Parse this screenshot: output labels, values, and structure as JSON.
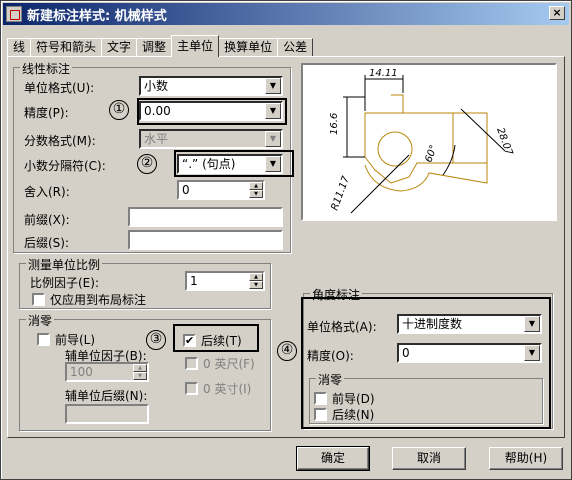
{
  "window": {
    "title": "新建标注样式: 机械样式",
    "close_label": "×"
  },
  "tabs": [
    "线",
    "符号和箭头",
    "文字",
    "调整",
    "主单位",
    "换算单位",
    "公差"
  ],
  "active_tab_index": 4,
  "linear": {
    "group_title": "线性标注",
    "unit_format_label": "单位格式(U):",
    "unit_format_value": "小数",
    "precision_label": "精度(P):",
    "precision_value": "0.00",
    "fraction_format_label": "分数格式(M):",
    "fraction_format_value": "水平",
    "decimal_sep_label": "小数分隔符(C):",
    "decimal_sep_value": "“.” (句点)",
    "round_label": "舍入(R):",
    "round_value": "0",
    "prefix_label": "前缀(X):",
    "prefix_value": "",
    "suffix_label": "后缀(S):",
    "suffix_value": ""
  },
  "scale": {
    "group_title": "测量单位比例",
    "factor_label": "比例因子(E):",
    "factor_value": "1",
    "layout_only_label": "仅应用到布局标注",
    "layout_only_checked": false
  },
  "zero_suppress": {
    "group_title": "消零",
    "leading_label": "前导(L)",
    "leading_checked": false,
    "trailing_label": "后续(T)",
    "trailing_checked": true,
    "sub_factor_label": "辅单位因子(B):",
    "sub_factor_value": "100",
    "feet_label": "0 英尺(F)",
    "inch_label": "0 英寸(I)",
    "sub_suffix_label": "辅单位后缀(N):",
    "sub_suffix_value": ""
  },
  "angular": {
    "group_title": "角度标注",
    "unit_format_label": "单位格式(A):",
    "unit_format_value": "十进制度数",
    "precision_label": "精度(O):",
    "precision_value": "0",
    "zero_group_title": "消零",
    "leading_label": "前导(D)",
    "leading_checked": false,
    "trailing_label": "后续(N)",
    "trailing_checked": false
  },
  "preview": {
    "dim_top": "14.11",
    "dim_left": "16.6",
    "dim_right": "28.07",
    "dim_angle": "60°",
    "dim_radius": "R11.17"
  },
  "annotations": [
    "①",
    "②",
    "③",
    "④"
  ],
  "buttons": {
    "ok": "确定",
    "cancel": "取消",
    "help": "帮助(H)"
  },
  "check_mark": "✔",
  "colors": {
    "title_start": "#0a246a",
    "title_end": "#a6caf0",
    "face": "#d4d0c8",
    "preview_line": "#b8860b"
  }
}
